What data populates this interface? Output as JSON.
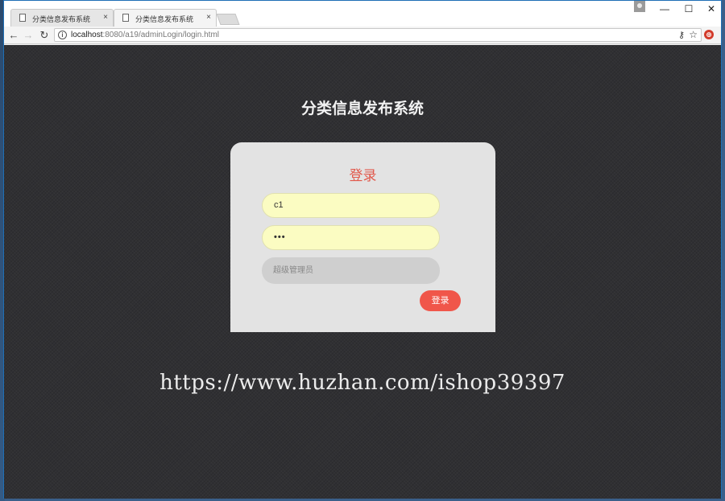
{
  "browser": {
    "tabs": [
      {
        "title": "分类信息发布系统",
        "active": false
      },
      {
        "title": "分类信息发布系统",
        "active": true
      }
    ],
    "tab_close_glyph": "×",
    "window_controls": {
      "minimize": "—",
      "maximize": "☐",
      "close": "✕"
    },
    "nav": {
      "back": "←",
      "forward": "→",
      "reload": "↻"
    },
    "address": {
      "host": "localhost",
      "path": ":8080/a19/adminLogin/login.html"
    },
    "icons": [
      "info-icon",
      "key-icon",
      "star-icon",
      "extension-icon",
      "profile-icon"
    ]
  },
  "page": {
    "site_title": "分类信息发布系统",
    "login": {
      "heading": "登录",
      "username_value": "c1",
      "password_value": "•••",
      "role_placeholder": "超级管理员",
      "submit_label": "登录"
    },
    "watermark": "https://www.huzhan.com/ishop39397"
  },
  "colors": {
    "page_background": "#303033",
    "card_background": "#e3e3e3",
    "accent": "#f0564a",
    "input_background": "#fbfcc2"
  }
}
